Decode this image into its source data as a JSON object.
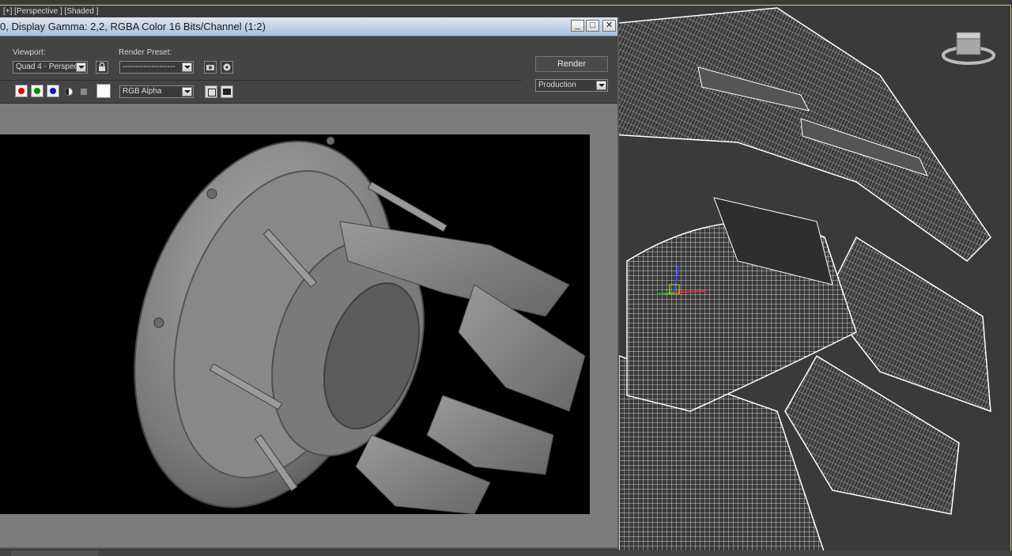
{
  "viewport": {
    "label": "[+] [Perspective ] [Shaded ]"
  },
  "render_window": {
    "title": "0, Display Gamma: 2,2, RGBA Color 16 Bits/Channel (1:2)",
    "buttons": {
      "minimize": "_",
      "maximize": "□",
      "close": "✕"
    },
    "viewport_label": "Viewport:",
    "viewport_value": "Quad 4 - Perspec",
    "render_preset_label": "Render Preset:",
    "render_preset_value": "--------------------",
    "render_button": "Render",
    "render_mode": "Production",
    "channel_display": "RGB Alpha"
  },
  "icons": {
    "lock": "lock-icon",
    "save_preset": "save-preset-icon",
    "render_setup": "render-setup-icon",
    "red_channel": "red-channel-icon",
    "green_channel": "green-channel-icon",
    "blue_channel": "blue-channel-icon",
    "alpha": "alpha-icon",
    "monochrome": "monochrome-icon",
    "swatch": "color-swatch-icon",
    "clone": "clone-window-icon",
    "clear": "clear-icon"
  },
  "colors": {
    "titlebar": "#a9c0dc",
    "toolbar": "#444444",
    "canvas": "#000000",
    "wireframe": "#ffffff",
    "viewport_bg": "#3a3a3a"
  }
}
